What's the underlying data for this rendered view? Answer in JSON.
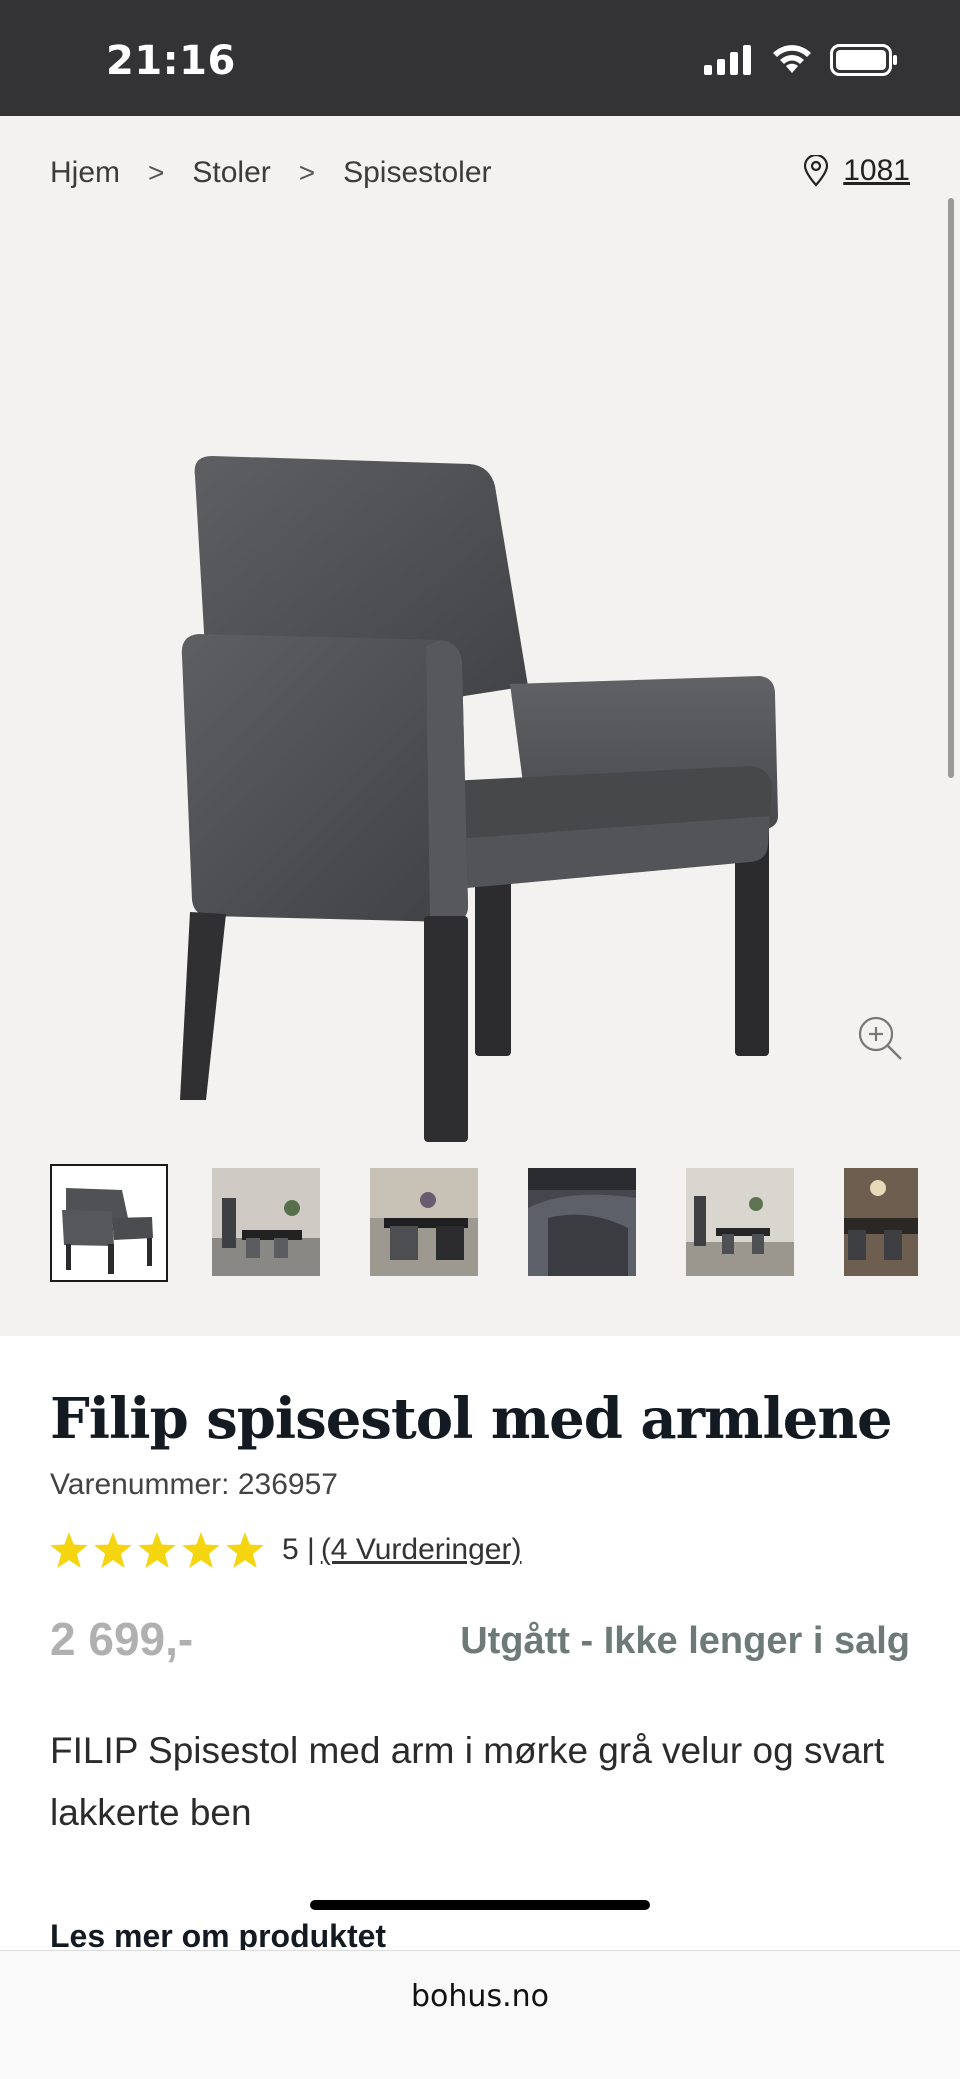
{
  "status_bar": {
    "time": "21:16"
  },
  "breadcrumb": {
    "items": [
      "Hjem",
      "Stoler",
      "Spisestoler"
    ],
    "separator": ">"
  },
  "store": {
    "code": "1081"
  },
  "product": {
    "title": "Filip spisestol med armlene",
    "sku_label": "Varenummer: 236957",
    "rating_value": "5 |",
    "reviews_link": "(4 Vurderinger)",
    "price": "2 699,-",
    "availability": "Utgått - Ikke lenger i salg",
    "description": "FILIP Spisestol med arm i mørke grå velur og svart lakkerte ben",
    "read_more": "Les mer om produktet",
    "stars": 5
  },
  "colors": {
    "star": "#f5d410",
    "title": "#141a22",
    "availability": "#6d7a78",
    "gallery_bg": "#f4f2f0"
  },
  "browser": {
    "url": "bohus.no"
  }
}
